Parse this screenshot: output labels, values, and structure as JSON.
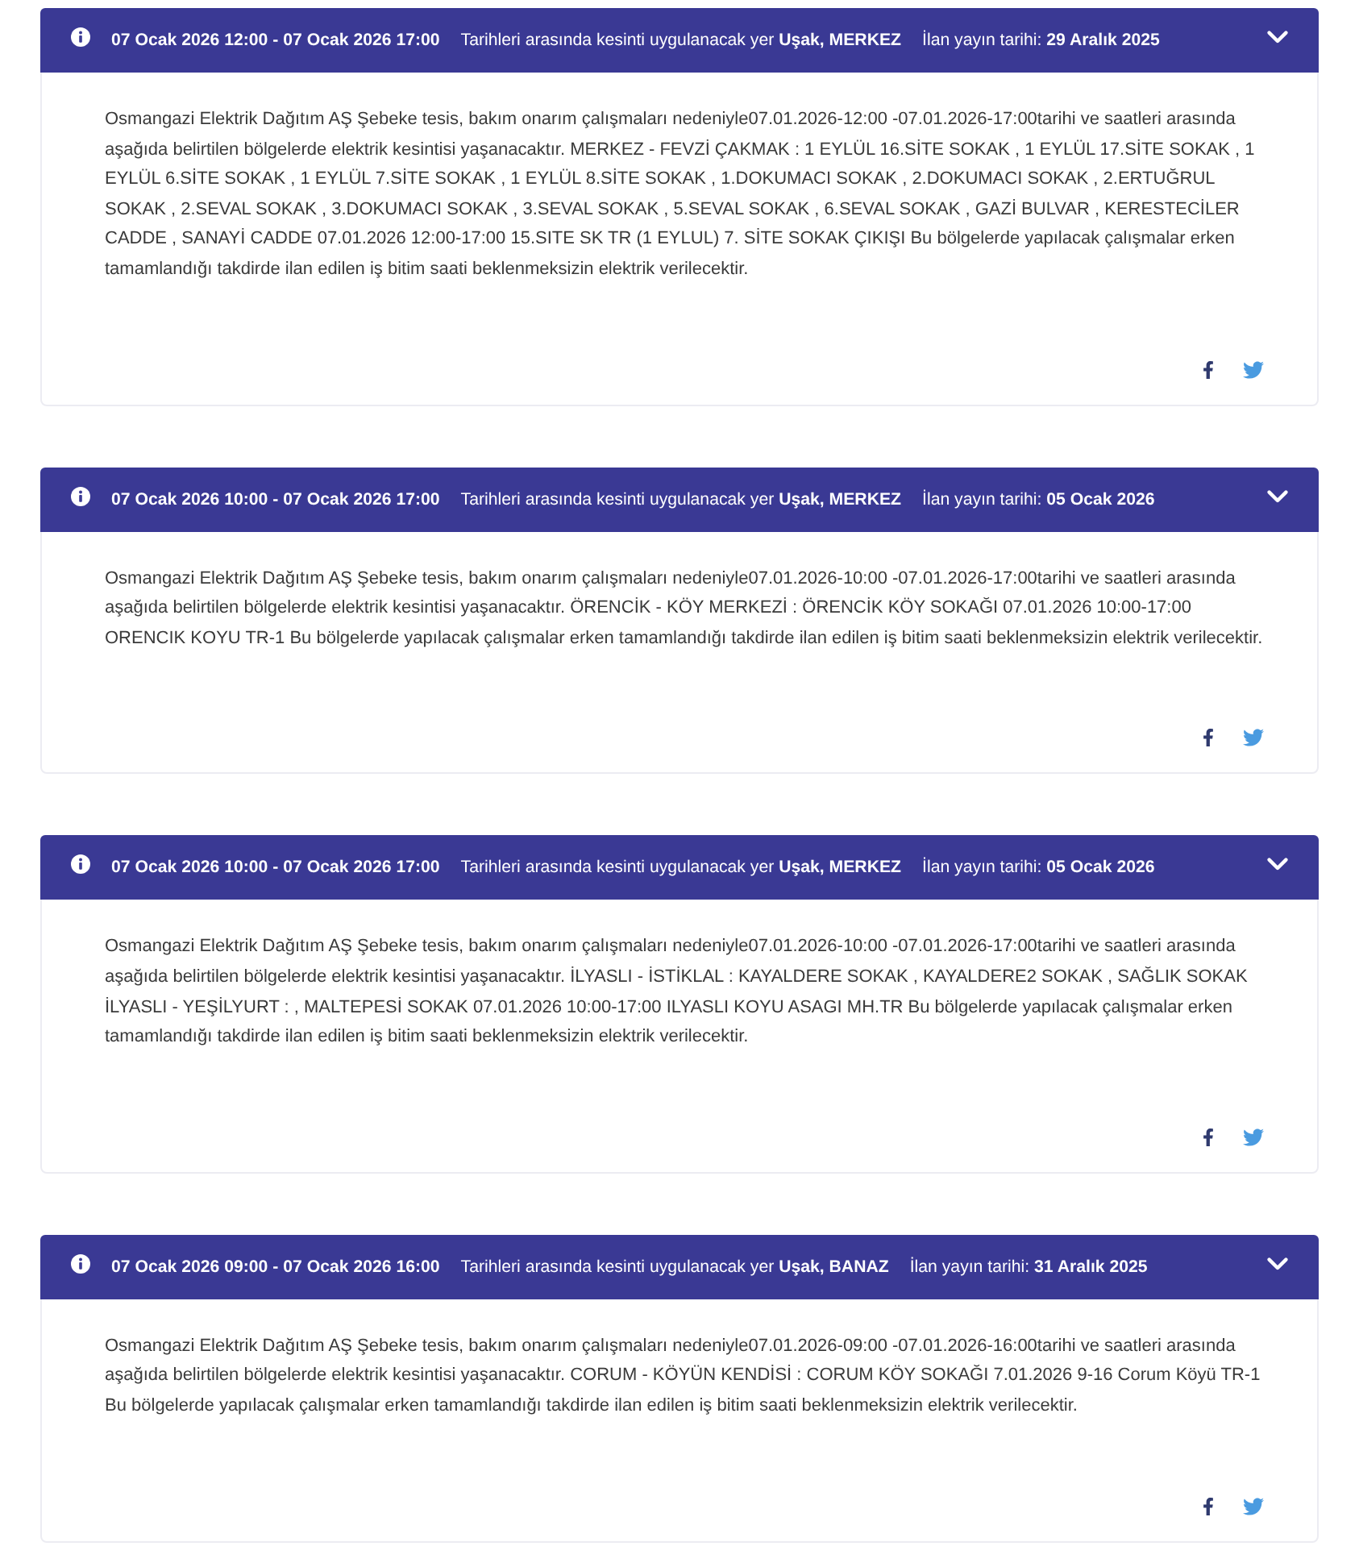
{
  "notices": [
    {
      "date_range": "07 Ocak 2026 12:00 - 07 Ocak 2026 17:00",
      "location_text": "Tarihleri arasında kesinti uygulanacak yer **Uşak, MERKEZ**",
      "published_text": "İlan yayın tarihi: **29 Aralık 2025**",
      "expanded": true,
      "body": "Osmangazi Elektrik Dağıtım AŞ Şebeke tesis, bakım onarım çalışmaları nedeniyle07.01.2026-12:00 -07.01.2026-17:00tarihi ve saatleri arasında aşağıda belirtilen bölgelerde elektrik kesintisi yaşanacaktır. MERKEZ - FEVZİ ÇAKMAK : 1 EYLÜL 16.SİTE SOKAK , 1 EYLÜL 17.SİTE SOKAK , 1 EYLÜL 6.SİTE SOKAK , 1 EYLÜL 7.SİTE SOKAK , 1 EYLÜL 8.SİTE SOKAK , 1.DOKUMACI SOKAK , 2.DOKUMACI SOKAK , 2.ERTUĞRUL SOKAK , 2.SEVAL SOKAK , 3.DOKUMACI SOKAK , 3.SEVAL SOKAK , 5.SEVAL SOKAK , 6.SEVAL SOKAK , GAZİ BULVAR , KERESTECİLER CADDE , SANAYİ CADDE 07.01.2026 12:00-17:00 15.SITE SK TR (1 EYLUL) 7. SİTE SOKAK ÇIKIŞI Bu bölgelerde yapılacak çalışmalar erken tamamlandığı takdirde ilan edilen iş bitim saati beklenmeksizin elektrik verilecektir."
    },
    {
      "date_range": "07 Ocak 2026 10:00 - 07 Ocak 2026 17:00",
      "location_text": "Tarihleri arasında kesinti uygulanacak yer **Uşak, MERKEZ**",
      "published_text": "İlan yayın tarihi: **05 Ocak 2026**",
      "expanded": true,
      "body": "Osmangazi Elektrik Dağıtım AŞ Şebeke tesis, bakım onarım çalışmaları nedeniyle07.01.2026-10:00 -07.01.2026-17:00tarihi ve saatleri arasında aşağıda belirtilen bölgelerde elektrik kesintisi yaşanacaktır. ÖRENCİK - KÖY MERKEZİ : ÖRENCİK KÖY SOKAĞI 07.01.2026 10:00-17:00 ORENCIK KOYU TR-1 Bu bölgelerde yapılacak çalışmalar erken tamamlandığı takdirde ilan edilen iş bitim saati beklenmeksizin elektrik verilecektir."
    },
    {
      "date_range": "07 Ocak 2026 10:00 - 07 Ocak 2026 17:00",
      "location_text": "Tarihleri arasında kesinti uygulanacak yer **Uşak, MERKEZ**",
      "published_text": "İlan yayın tarihi: **05 Ocak 2026**",
      "expanded": true,
      "body": "Osmangazi Elektrik Dağıtım AŞ Şebeke tesis, bakım onarım çalışmaları nedeniyle07.01.2026-10:00 -07.01.2026-17:00tarihi ve saatleri arasında aşağıda belirtilen bölgelerde elektrik kesintisi yaşanacaktır. İLYASLI - İSTİKLAL : KAYALDERE SOKAK , KAYALDERE2 SOKAK , SAĞLIK SOKAK İLYASLI - YEŞİLYURT : , MALTEPESİ SOKAK 07.01.2026 10:00-17:00 ILYASLI KOYU ASAGI MH.TR Bu bölgelerde yapılacak çalışmalar erken tamamlandığı takdirde ilan edilen iş bitim saati beklenmeksizin elektrik verilecektir."
    },
    {
      "date_range": "07 Ocak 2026 09:00 - 07 Ocak 2026 16:00",
      "location_text": "Tarihleri arasında kesinti uygulanacak yer **Uşak, BANAZ**",
      "published_text": "İlan yayın tarihi: **31 Aralık 2025**",
      "expanded": true,
      "body": "Osmangazi Elektrik Dağıtım AŞ Şebeke tesis, bakım onarım çalışmaları nedeniyle07.01.2026-09:00 -07.01.2026-16:00tarihi ve saatleri arasında aşağıda belirtilen bölgelerde elektrik kesintisi yaşanacaktır. CORUM - KÖYÜN KENDİSİ : CORUM KÖY SOKAĞI 7.01.2026 9-16 Corum Köyü TR-1 Bu bölgelerde yapılacak çalışmalar erken tamamlandığı takdirde ilan edilen iş bitim saati beklenmeksizin elektrik verilecektir."
    }
  ]
}
